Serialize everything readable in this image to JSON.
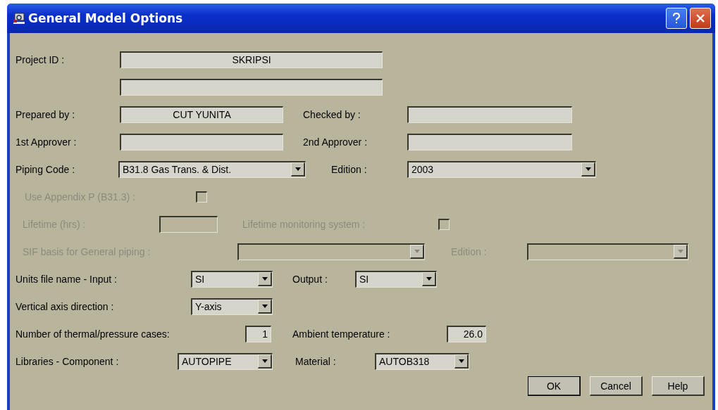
{
  "window": {
    "title": "General Model Options"
  },
  "rows": [
    {
      "items": [
        {
          "kind": "label",
          "text": "Project ID  :",
          "disabled": false
        },
        {
          "kind": "text",
          "value": "SKRIPSI",
          "disabled": false
        }
      ]
    },
    {
      "items": [
        {
          "kind": "text",
          "value": "",
          "disabled": false
        }
      ]
    },
    {
      "items": [
        {
          "kind": "label",
          "text": "Prepared by  :",
          "disabled": false
        },
        {
          "kind": "text",
          "value": "CUT YUNITA",
          "disabled": false
        },
        {
          "kind": "label",
          "text": "Checked by  :",
          "disabled": false
        },
        {
          "kind": "text",
          "value": "",
          "disabled": false
        }
      ]
    },
    {
      "items": [
        {
          "kind": "label",
          "text": "1st Approver :",
          "disabled": false
        },
        {
          "kind": "text",
          "value": "",
          "disabled": false
        },
        {
          "kind": "label",
          "text": "2nd Approver :",
          "disabled": false
        },
        {
          "kind": "text",
          "value": "",
          "disabled": false
        }
      ]
    },
    {
      "items": [
        {
          "kind": "label",
          "text": "Piping Code  :",
          "disabled": false
        },
        {
          "kind": "combo",
          "value": "B31.8 Gas Trans. & Dist.",
          "disabled": false
        },
        {
          "kind": "label",
          "text": "Edition :",
          "disabled": false
        },
        {
          "kind": "combo",
          "value": "2003",
          "disabled": false
        }
      ]
    },
    {
      "items": [
        {
          "kind": "label",
          "text": "Use Appendix P (B31.3) :",
          "disabled": true
        },
        {
          "kind": "checkbox",
          "checked": false,
          "disabled": true
        }
      ]
    },
    {
      "items": [
        {
          "kind": "label",
          "text": "Lifetime (hrs) :",
          "disabled": true
        },
        {
          "kind": "text",
          "value": "",
          "disabled": true
        },
        {
          "kind": "label",
          "text": "Lifetime monitoring system :",
          "disabled": true
        },
        {
          "kind": "checkbox",
          "checked": false,
          "disabled": true
        }
      ]
    },
    {
      "items": [
        {
          "kind": "label",
          "text": "SIF basis for General piping :",
          "disabled": true
        },
        {
          "kind": "combo",
          "value": "",
          "disabled": true
        },
        {
          "kind": "label",
          "text": "Edition :",
          "disabled": true
        },
        {
          "kind": "combo",
          "value": "",
          "disabled": true
        }
      ]
    },
    {
      "items": [
        {
          "kind": "label",
          "text": "Units file name - Input :",
          "disabled": false
        },
        {
          "kind": "combo",
          "value": "SI",
          "disabled": false
        },
        {
          "kind": "label",
          "text": "Output :",
          "disabled": false
        },
        {
          "kind": "combo",
          "value": "SI",
          "disabled": false
        }
      ]
    },
    {
      "items": [
        {
          "kind": "label",
          "text": "Vertical axis direction :",
          "disabled": false
        },
        {
          "kind": "combo",
          "value": "Y-axis",
          "disabled": false
        }
      ]
    },
    {
      "items": [
        {
          "kind": "label",
          "text": "Number of thermal/pressure cases:",
          "disabled": false
        },
        {
          "kind": "text",
          "value": "1",
          "disabled": false
        },
        {
          "kind": "label",
          "text": "Ambient temperature :",
          "disabled": false
        },
        {
          "kind": "text",
          "value": "26.0",
          "disabled": false
        }
      ]
    },
    {
      "items": [
        {
          "kind": "label",
          "text": "Libraries - Component :",
          "disabled": false
        },
        {
          "kind": "combo",
          "value": "AUTOPIPE",
          "disabled": false
        },
        {
          "kind": "label",
          "text": "Material :",
          "disabled": false
        },
        {
          "kind": "combo",
          "value": "AUTOB318",
          "disabled": false
        }
      ]
    }
  ],
  "buttons": [
    {
      "label": "OK",
      "default": true
    },
    {
      "label": "Cancel",
      "default": false
    },
    {
      "label": "Help",
      "default": false
    }
  ]
}
